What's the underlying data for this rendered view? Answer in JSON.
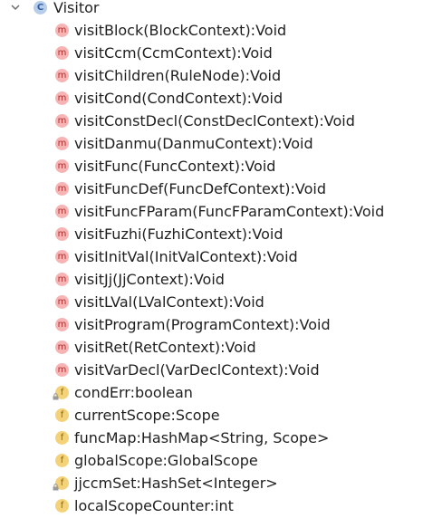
{
  "tree": {
    "class_node": {
      "icon_letter": "C",
      "name": "Visitor",
      "expanded": true
    },
    "members": [
      {
        "kind": "method",
        "icon_letter": "m",
        "label": "visitBlock(BlockContext):Void",
        "private": false
      },
      {
        "kind": "method",
        "icon_letter": "m",
        "label": "visitCcm(CcmContext):Void",
        "private": false
      },
      {
        "kind": "method",
        "icon_letter": "m",
        "label": "visitChildren(RuleNode):Void",
        "private": false
      },
      {
        "kind": "method",
        "icon_letter": "m",
        "label": "visitCond(CondContext):Void",
        "private": false
      },
      {
        "kind": "method",
        "icon_letter": "m",
        "label": "visitConstDecl(ConstDeclContext):Void",
        "private": false
      },
      {
        "kind": "method",
        "icon_letter": "m",
        "label": "visitDanmu(DanmuContext):Void",
        "private": false
      },
      {
        "kind": "method",
        "icon_letter": "m",
        "label": "visitFunc(FuncContext):Void",
        "private": false
      },
      {
        "kind": "method",
        "icon_letter": "m",
        "label": "visitFuncDef(FuncDefContext):Void",
        "private": false
      },
      {
        "kind": "method",
        "icon_letter": "m",
        "label": "visitFuncFParam(FuncFParamContext):Void",
        "private": false
      },
      {
        "kind": "method",
        "icon_letter": "m",
        "label": "visitFuzhi(FuzhiContext):Void",
        "private": false
      },
      {
        "kind": "method",
        "icon_letter": "m",
        "label": "visitInitVal(InitValContext):Void",
        "private": false
      },
      {
        "kind": "method",
        "icon_letter": "m",
        "label": "visitJj(JjContext):Void",
        "private": false
      },
      {
        "kind": "method",
        "icon_letter": "m",
        "label": "visitLVal(LValContext):Void",
        "private": false
      },
      {
        "kind": "method",
        "icon_letter": "m",
        "label": "visitProgram(ProgramContext):Void",
        "private": false
      },
      {
        "kind": "method",
        "icon_letter": "m",
        "label": "visitRet(RetContext):Void",
        "private": false
      },
      {
        "kind": "method",
        "icon_letter": "m",
        "label": "visitVarDecl(VarDeclContext):Void",
        "private": false
      },
      {
        "kind": "field",
        "icon_letter": "f",
        "label": "condErr:boolean",
        "private": true
      },
      {
        "kind": "field",
        "icon_letter": "f",
        "label": "currentScope:Scope",
        "private": false
      },
      {
        "kind": "field",
        "icon_letter": "f",
        "label": "funcMap:HashMap<String, Scope>",
        "private": false
      },
      {
        "kind": "field",
        "icon_letter": "f",
        "label": "globalScope:GlobalScope",
        "private": false
      },
      {
        "kind": "field",
        "icon_letter": "f",
        "label": "jjccmSet:HashSet<Integer>",
        "private": true
      },
      {
        "kind": "field",
        "icon_letter": "f",
        "label": "localScopeCounter:int",
        "private": false
      }
    ]
  }
}
